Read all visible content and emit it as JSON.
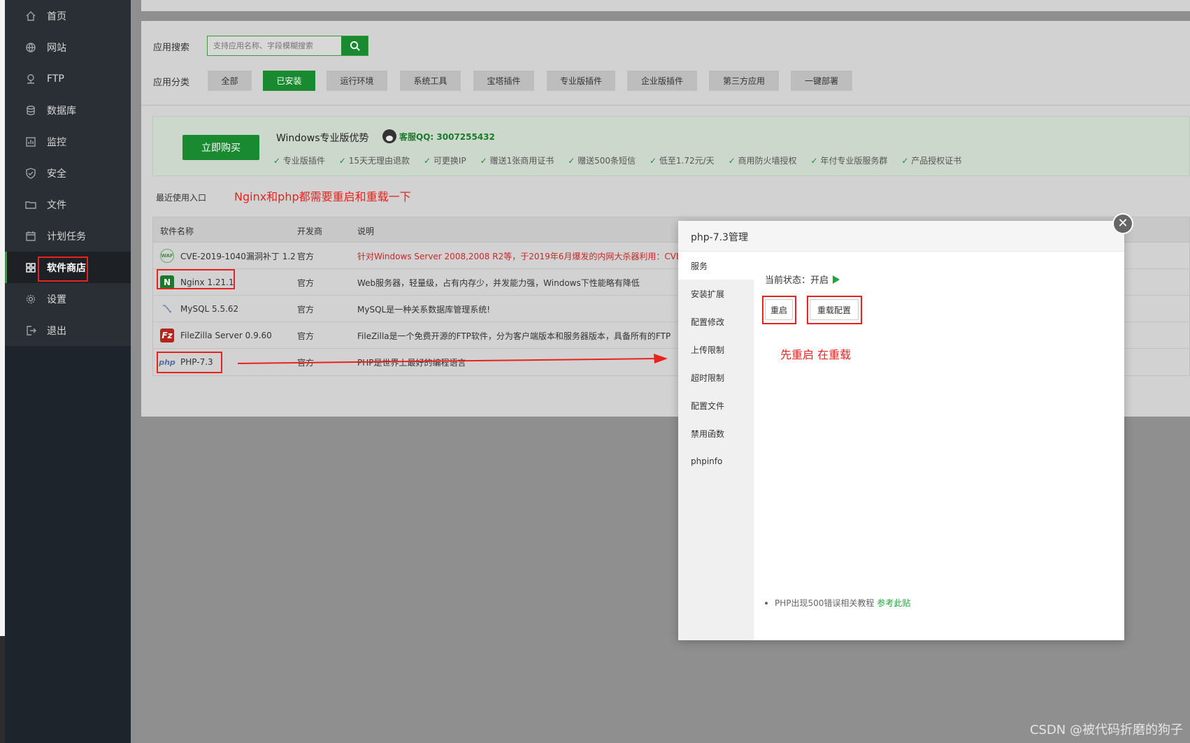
{
  "sidebar": {
    "items": [
      {
        "label": "首页",
        "icon": "home-icon"
      },
      {
        "label": "网站",
        "icon": "globe-icon"
      },
      {
        "label": "FTP",
        "icon": "ftp-icon"
      },
      {
        "label": "数据库",
        "icon": "database-icon"
      },
      {
        "label": "监控",
        "icon": "monitor-icon"
      },
      {
        "label": "安全",
        "icon": "shield-icon"
      },
      {
        "label": "文件",
        "icon": "folder-icon"
      },
      {
        "label": "计划任务",
        "icon": "calendar-icon"
      },
      {
        "label": "软件商店",
        "icon": "grid-icon",
        "active": true
      },
      {
        "label": "设置",
        "icon": "gear-icon"
      },
      {
        "label": "退出",
        "icon": "logout-icon"
      }
    ]
  },
  "search": {
    "label": "应用搜索",
    "placeholder": "支持应用名称、字段模糊搜索"
  },
  "categories": {
    "label": "应用分类",
    "items": [
      "全部",
      "已安装",
      "运行环境",
      "系统工具",
      "宝塔插件",
      "专业版插件",
      "企业版插件",
      "第三方应用",
      "一键部署"
    ],
    "active": "已安装"
  },
  "promo": {
    "buy_label": "立即购买",
    "title": "Windows专业版优势",
    "qq": "客服QQ: 3007255432",
    "features": [
      "专业版插件",
      "15天无理由退款",
      "可更换IP",
      "赠送1张商用证书",
      "赠送500条短信",
      "低至1.72元/天",
      "商用防火墙授权",
      "年付专业版服务群",
      "产品授权证书"
    ]
  },
  "recent_label": "最近使用入口",
  "annotation_top": "Nginx和php都需要重启和重载一下",
  "table": {
    "headers": [
      "软件名称",
      "开发商",
      "说明"
    ],
    "rows": [
      {
        "name": "CVE-2019-1040漏洞补丁 1.2",
        "dev": "官方",
        "desc": "针对Windows Server 2008,2008 R2等，于2019年6月爆发的内网大杀器利用：CVE",
        "icon": "waf-icon",
        "icon_text": "WAF",
        "red": true
      },
      {
        "name": "Nginx 1.21.1",
        "dev": "官方",
        "desc": "Web服务器，轻量级，占有内存少，并发能力强，Windows下性能略有降低",
        "icon": "nginx-icon",
        "icon_text": "N",
        "red": false
      },
      {
        "name": "MySQL 5.5.62",
        "dev": "官方",
        "desc": "MySQL是一种关系数据库管理系统!",
        "icon": "mysql-icon",
        "icon_text": "",
        "red": false
      },
      {
        "name": "FileZilla Server 0.9.60",
        "dev": "官方",
        "desc": "FileZilla是一个免费开源的FTP软件，分为客户端版本和服务器版本，具备所有的FTP",
        "icon": "filezilla-icon",
        "icon_text": "Fz",
        "red": false
      },
      {
        "name": "PHP-7.3",
        "dev": "官方",
        "desc": "PHP是世界上最好的编程语言",
        "icon": "php-icon",
        "icon_text": "php",
        "red": false
      }
    ]
  },
  "modal": {
    "title": "php-7.3管理",
    "close_label": "✕",
    "menu": [
      "服务",
      "安装扩展",
      "配置修改",
      "上传限制",
      "超时限制",
      "配置文件",
      "禁用函数",
      "phpinfo"
    ],
    "status_label": "当前状态：开启",
    "restart_label": "重启",
    "reload_label": "重载配置",
    "note": "先重启 在重载",
    "tip_text": "PHP出现500错误相关教程",
    "tip_link": "参考此贴"
  },
  "watermark": "CSDN @被代码折磨的狗子",
  "colors": {
    "accent": "#20a53a",
    "annotation": "#e8231f",
    "sidebar": "#1e242b"
  }
}
